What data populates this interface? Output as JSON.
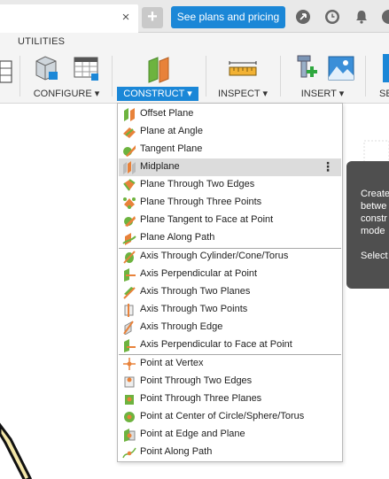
{
  "topbar": {
    "close_glyph": "×",
    "new_tab_glyph": "+",
    "plans_button": "See plans and pricing",
    "icons": [
      "recovery-icon",
      "clock-icon",
      "bell-icon",
      "help-icon"
    ]
  },
  "toolbar": {
    "tab_label": "UTILITIES",
    "groups": [
      {
        "label": "CONFIGURE ▾"
      },
      {
        "label": "CONSTRUCT ▾"
      },
      {
        "label": "INSPECT ▾"
      },
      {
        "label": "INSERT ▾"
      },
      {
        "label": "SE"
      }
    ]
  },
  "tooltip": {
    "lines": [
      "Create",
      "betwe",
      "constr",
      "mode"
    ],
    "bold_line": "Select"
  },
  "menu": {
    "items": [
      {
        "label": "Offset Plane",
        "icon": "offset-plane-icon"
      },
      {
        "label": "Plane at Angle",
        "icon": "plane-at-angle-icon"
      },
      {
        "label": "Tangent Plane",
        "icon": "tangent-plane-icon"
      },
      {
        "label": "Midplane",
        "icon": "midplane-icon",
        "highlighted": true,
        "more": "⋮"
      },
      {
        "label": "Plane Through Two Edges",
        "icon": "plane-two-edges-icon"
      },
      {
        "label": "Plane Through Three Points",
        "icon": "plane-three-points-icon"
      },
      {
        "label": "Plane Tangent to Face at Point",
        "icon": "plane-tangent-face-icon"
      },
      {
        "label": "Plane Along Path",
        "icon": "plane-along-path-icon"
      },
      {
        "label": "Axis Through Cylinder/Cone/Torus",
        "icon": "axis-cylinder-icon"
      },
      {
        "label": "Axis Perpendicular at Point",
        "icon": "axis-perpendicular-point-icon"
      },
      {
        "label": "Axis Through Two Planes",
        "icon": "axis-two-planes-icon"
      },
      {
        "label": "Axis Through Two Points",
        "icon": "axis-two-points-icon"
      },
      {
        "label": "Axis Through Edge",
        "icon": "axis-edge-icon"
      },
      {
        "label": "Axis Perpendicular to Face at Point",
        "icon": "axis-perpendicular-face-icon"
      },
      {
        "label": "Point at Vertex",
        "icon": "point-vertex-icon"
      },
      {
        "label": "Point Through Two Edges",
        "icon": "point-two-edges-icon"
      },
      {
        "label": "Point Through Three Planes",
        "icon": "point-three-planes-icon"
      },
      {
        "label": "Point at Center of Circle/Sphere/Torus",
        "icon": "point-center-icon"
      },
      {
        "label": "Point at Edge and Plane",
        "icon": "point-edge-plane-icon"
      },
      {
        "label": "Point Along Path",
        "icon": "point-along-path-icon"
      }
    ]
  },
  "colors": {
    "accent": "#1b87d7",
    "plane_green": "#6db33f",
    "plane_orange": "#e8823a",
    "menu_highlight": "#dcdcdc",
    "tooltip_bg": "#4f4f4f"
  }
}
